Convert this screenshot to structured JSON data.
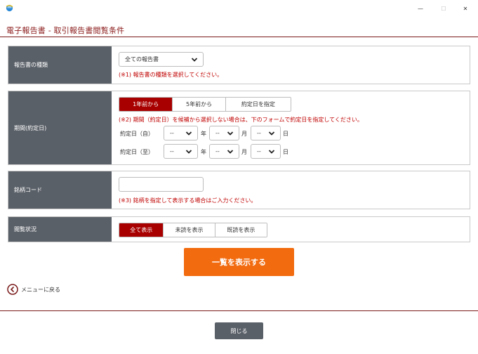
{
  "window": {
    "minimize_glyph": "—",
    "maximize_glyph": "☐",
    "close_glyph": "✕"
  },
  "page": {
    "title": "電子報告書 - 取引報告書閲覧条件"
  },
  "report_type": {
    "label": "報告書の種類",
    "selected": "全ての報告書",
    "note": "(※1) 報告書の種類を選択してください。"
  },
  "period": {
    "label": "期間(約定日)",
    "options": [
      "1年前から",
      "5年前から",
      "約定日を指定"
    ],
    "active_index": 0,
    "note": "(※2) 期間（約定日）を候補から選択しない場合は、下のフォームで約定日を指定してください。",
    "from_label": "約定日（自）",
    "to_label": "約定日（至）",
    "year_unit": "年",
    "month_unit": "月",
    "day_unit": "日",
    "from_year": "--",
    "from_month": "--",
    "from_day": "--",
    "to_year": "--",
    "to_month": "--",
    "to_day": "--"
  },
  "brand_code": {
    "label": "銘柄コード",
    "value": "",
    "note": "(※3) 銘柄を指定して表示する場合はご入力ください。"
  },
  "read_status": {
    "label": "閲覧状況",
    "options": [
      "全て表示",
      "未読を表示",
      "既読を表示"
    ],
    "active_index": 0
  },
  "actions": {
    "show_list": "一覧を表示する",
    "back_to_menu": "メニューに戻る",
    "close": "閉じる"
  },
  "colors": {
    "accent": "#a80000",
    "title": "#8b1a1a",
    "label_bg": "#5a6068",
    "primary": "#f26b0f",
    "note": "#c00000"
  },
  "icons": {
    "app": "browser-app-icon",
    "back": "circle-chevron-left-icon",
    "dropdown": "chevron-down-icon"
  }
}
